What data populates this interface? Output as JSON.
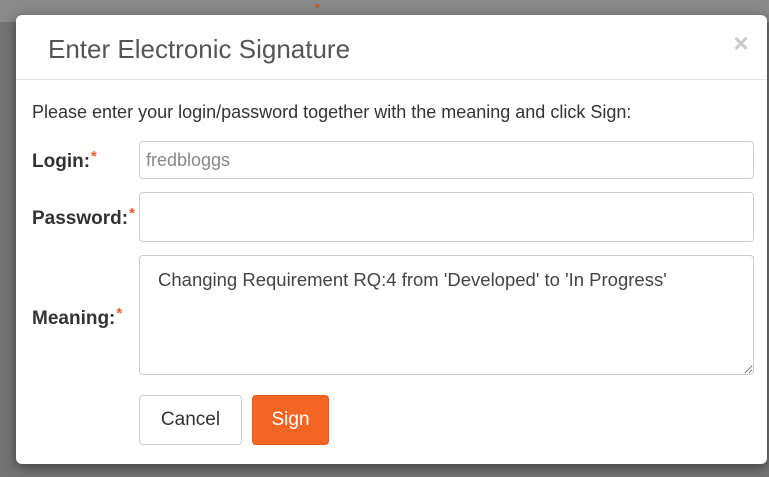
{
  "dialog": {
    "title": "Enter Electronic Signature",
    "close_symbol": "×",
    "close_icon": "close-icon",
    "instructions": "Please enter your login/password together with the meaning and click Sign:",
    "required_marker": "*"
  },
  "form": {
    "login_label": "Login:",
    "login_value": "fredbloggs",
    "password_label": "Password:",
    "password_value": "",
    "meaning_label": "Meaning:",
    "meaning_value": "Changing Requirement RQ:4 from 'Developed' to 'In Progress'"
  },
  "buttons": {
    "cancel_label": "Cancel",
    "sign_label": "Sign"
  },
  "colors": {
    "accent": "#f26522",
    "required_marker": "#f05a22",
    "title_text": "#555555",
    "overlay": "#737373"
  }
}
